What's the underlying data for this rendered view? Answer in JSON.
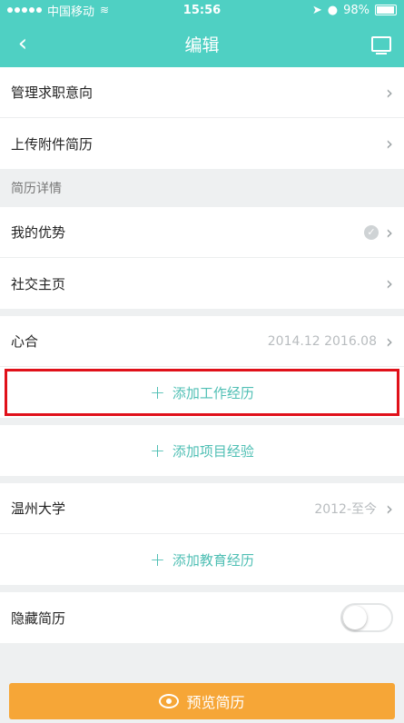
{
  "status_bar": {
    "carrier": "中国移动",
    "time": "15:56",
    "battery": "98%"
  },
  "nav": {
    "title": "编辑"
  },
  "top_items": [
    {
      "label": "管理求职意向"
    },
    {
      "label": "上传附件简历"
    }
  ],
  "details_header": "简历详情",
  "details_items": [
    {
      "label": "我的优势"
    },
    {
      "label": "社交主页"
    }
  ],
  "work": {
    "company": "心合",
    "dates": "2014.12  2016.08",
    "add_work_label": "添加工作经历"
  },
  "project": {
    "add_label": "添加项目经验"
  },
  "education": {
    "school": "温州大学",
    "dates": "2012-至今",
    "add_label": "添加教育经历"
  },
  "hide_resume": {
    "label": "隐藏简历",
    "enabled": false
  },
  "preview": {
    "label": "预览简历"
  },
  "colors": {
    "accent": "#4fd0c3",
    "highlight": "#e0111a",
    "preview_bar": "#f6a637"
  }
}
